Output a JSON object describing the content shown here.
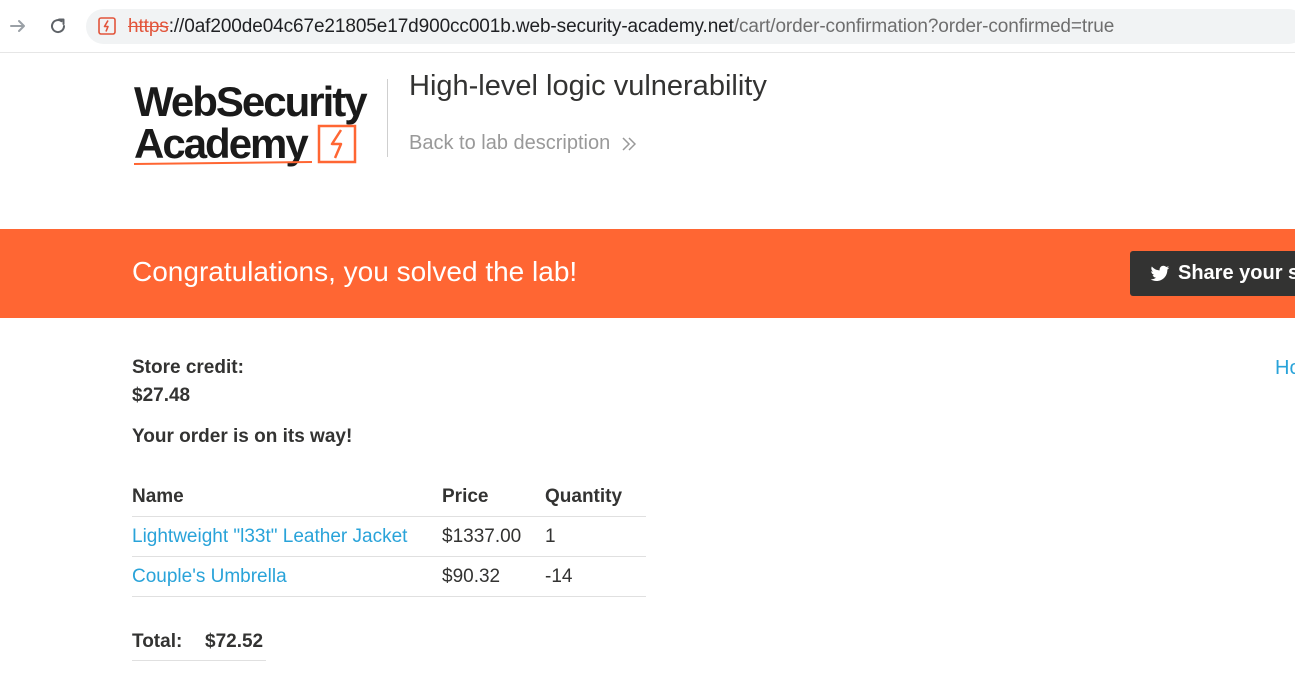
{
  "browser": {
    "url_scheme": "https",
    "url_separator": "://",
    "url_host": "0af200de04c67e21805e17d900cc001b.web-security-academy.net",
    "url_path": "/cart/order-confirmation?order-confirmed=true",
    "icons": [
      "forward-icon",
      "reload-icon",
      "not-secure-icon"
    ]
  },
  "header": {
    "logo_line1": "WebSecurity",
    "logo_line2": "Academy",
    "lab_title": "High-level logic vulnerability",
    "back_link": "Back to lab description"
  },
  "banner": {
    "message": "Congratulations, you solved the lab!",
    "share_label": "Share your s"
  },
  "account": {
    "store_credit_label": "Store credit:",
    "store_credit_value": "$27.48",
    "home_link": "Ho"
  },
  "order": {
    "status_message": "Your order is on its way!",
    "columns": [
      "Name",
      "Price",
      "Quantity"
    ],
    "rows": [
      {
        "name": "Lightweight \"l33t\" Leather Jacket",
        "price": "$1337.00",
        "quantity": "1"
      },
      {
        "name": "Couple's Umbrella",
        "price": "$90.32",
        "quantity": "-14"
      }
    ],
    "total_label": "Total:",
    "total_value": "$72.52"
  },
  "colors": {
    "accent": "#ff6633",
    "link": "#29a3d9",
    "text": "#333332",
    "share_button": "#333332"
  }
}
